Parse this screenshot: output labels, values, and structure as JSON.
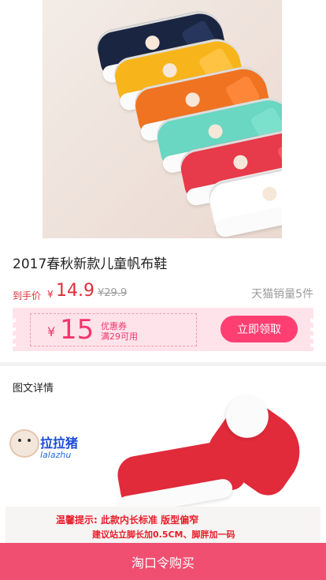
{
  "product": {
    "title": "2017春秋新款儿童帆布鞋",
    "price_label": "到手价",
    "currency": "¥",
    "price": "14.9",
    "original_price": "¥29.9",
    "sales": "天猫销量5件",
    "image_icon": "shoe-product-image"
  },
  "coupon": {
    "currency": "¥",
    "amount": "15",
    "name": "优惠券",
    "condition": "满29可用",
    "button_label": "立即领取"
  },
  "detail": {
    "title": "图文详情",
    "brand_cn": "拉拉猪",
    "brand_en": "lalazhu",
    "notice_line1": "温馨提示: 此款内长标准  版型偏窄",
    "notice_line2": "建议站立脚长加0.5CM、脚胖加一码"
  },
  "footer": {
    "buy_label": "淘口令购买"
  },
  "colors": {
    "accent": "#f04f72",
    "price_red": "#e02e3a",
    "coupon_pink": "#ff3f72"
  }
}
